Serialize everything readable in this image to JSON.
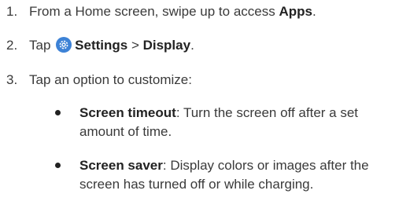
{
  "steps": [
    {
      "number": "1.",
      "text_before": "From a Home screen, swipe up to access ",
      "bold": "Apps",
      "text_after": "."
    },
    {
      "number": "2.",
      "text_before": "Tap",
      "bold_1": "Settings",
      "separator": " > ",
      "bold_2": "Display",
      "text_after": ".",
      "icon": "settings-gear-icon"
    },
    {
      "number": "3.",
      "text": "Tap an option to customize:"
    }
  ],
  "options": [
    {
      "bold": "Screen timeout",
      "line1": ": Turn the screen off after a set",
      "line2": "amount of time."
    },
    {
      "bold": "Screen saver",
      "line1": ": Display colors or images after the",
      "line2": "screen has turned off or while charging."
    }
  ],
  "colors": {
    "text": "#3a3a3a",
    "bold": "#222222",
    "icon_bg": "#3d82d6"
  }
}
